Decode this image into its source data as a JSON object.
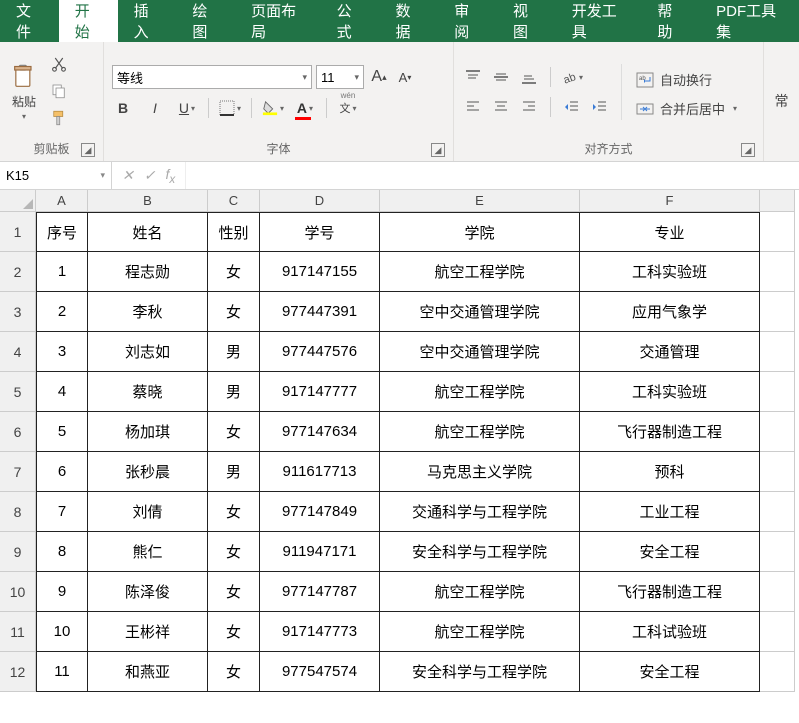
{
  "tabs": [
    "文件",
    "开始",
    "插入",
    "绘图",
    "页面布局",
    "公式",
    "数据",
    "审阅",
    "视图",
    "开发工具",
    "帮助",
    "PDF工具集"
  ],
  "active_tab": 1,
  "clipboard": {
    "paste": "粘贴",
    "group": "剪贴板"
  },
  "font": {
    "name": "等线",
    "size": "11",
    "group": "字体",
    "wen": "wén"
  },
  "align": {
    "group": "对齐方式",
    "wrap": "自动换行",
    "merge": "合并后居中"
  },
  "namebox": "K15",
  "columns": [
    "A",
    "B",
    "C",
    "D",
    "E",
    "F"
  ],
  "col_widths": [
    "cw-A",
    "cw-B",
    "cw-C",
    "cw-D",
    "cw-E",
    "cw-F",
    "cw-G"
  ],
  "table_headers": [
    "序号",
    "姓名",
    "性别",
    "学号",
    "学院",
    "专业"
  ],
  "rows": [
    [
      "1",
      "程志勋",
      "女",
      "917147155",
      "航空工程学院",
      "工科实验班"
    ],
    [
      "2",
      "李秋",
      "女",
      "977447391",
      "空中交通管理学院",
      "应用气象学"
    ],
    [
      "3",
      "刘志如",
      "男",
      "977447576",
      "空中交通管理学院",
      "交通管理"
    ],
    [
      "4",
      "蔡晓",
      "男",
      "917147777",
      "航空工程学院",
      "工科实验班"
    ],
    [
      "5",
      "杨加琪",
      "女",
      "977147634",
      "航空工程学院",
      "飞行器制造工程"
    ],
    [
      "6",
      "张秒晨",
      "男",
      "911617713",
      "马克思主义学院",
      "预科"
    ],
    [
      "7",
      "刘倩",
      "女",
      "977147849",
      "交通科学与工程学院",
      "工业工程"
    ],
    [
      "8",
      "熊仁",
      "女",
      "911947171",
      "安全科学与工程学院",
      "安全工程"
    ],
    [
      "9",
      "陈泽俊",
      "女",
      "977147787",
      "航空工程学院",
      "飞行器制造工程"
    ],
    [
      "10",
      "王彬祥",
      "女",
      "917147773",
      "航空工程学院",
      "工科试验班"
    ],
    [
      "11",
      "和燕亚",
      "女",
      "977547574",
      "安全科学与工程学院",
      "安全工程"
    ]
  ]
}
